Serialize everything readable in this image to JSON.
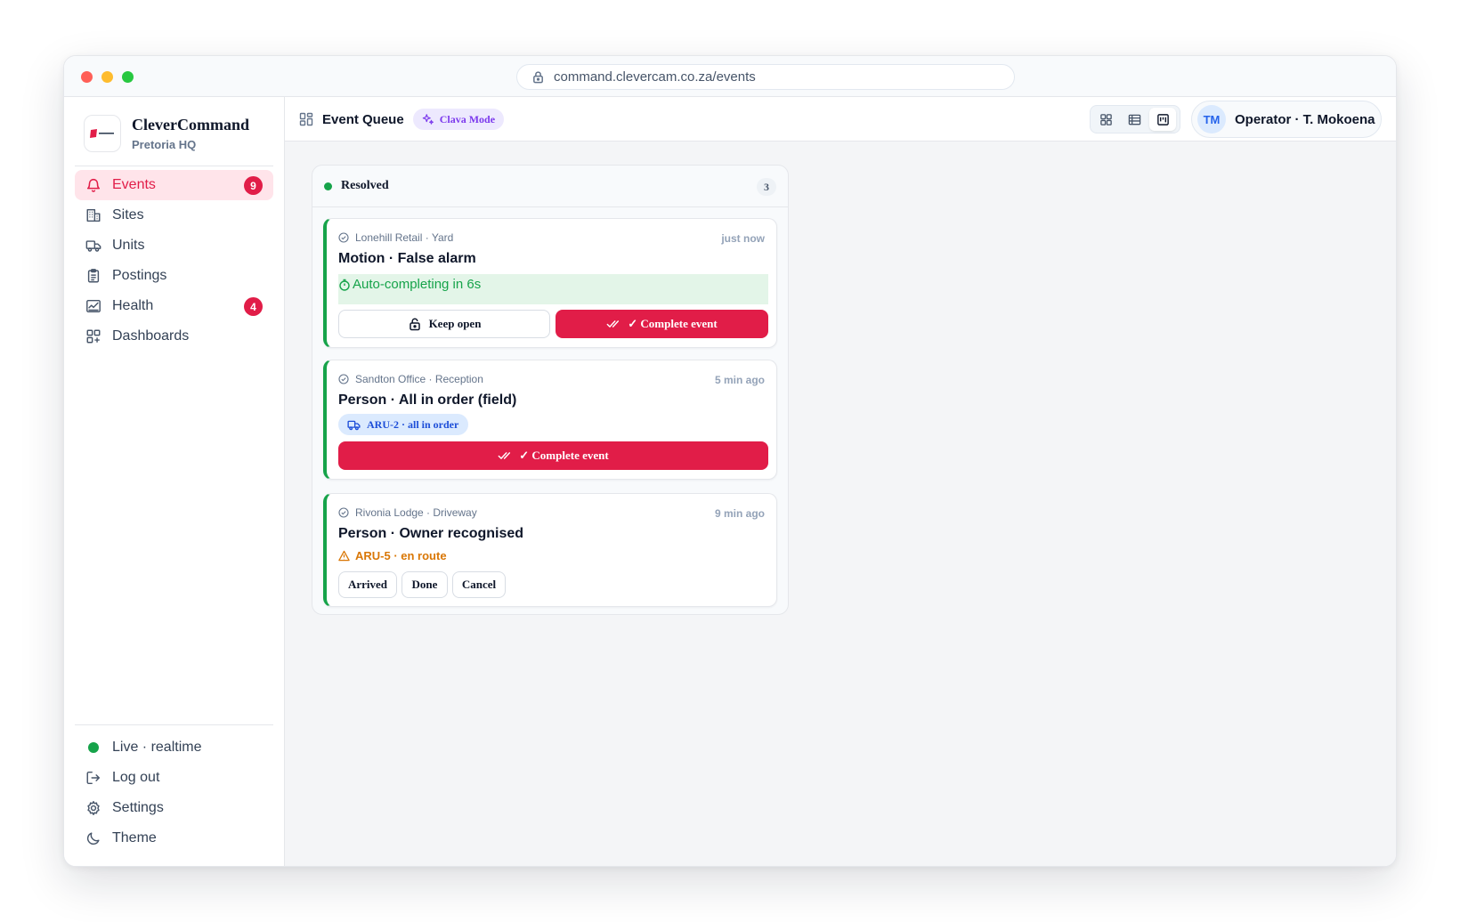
{
  "browser": {
    "url": "command.clevercam.co.za/events"
  },
  "brand": {
    "name": "CleverCommand",
    "subtitle": "Pretoria HQ"
  },
  "sidebar": {
    "items": [
      {
        "label": "Events",
        "badge": "9"
      },
      {
        "label": "Sites"
      },
      {
        "label": "Units"
      },
      {
        "label": "Postings"
      },
      {
        "label": "Health",
        "badge": "4"
      },
      {
        "label": "Dashboards"
      }
    ],
    "bottom": {
      "live": "Live · realtime",
      "logout": "Log out",
      "settings": "Settings",
      "theme": "Theme"
    }
  },
  "topbar": {
    "title": "Event Queue",
    "mode_badge": "Clava Mode",
    "operator_initials": "TM",
    "operator_name": "Operator · T. Mokoena"
  },
  "column": {
    "title": "Resolved",
    "count": "3",
    "status_color": "#16a34a"
  },
  "cards": [
    {
      "site": "Lonehill Retail · Yard",
      "time": "just now",
      "title": "Motion · False alarm",
      "auto": "Auto-completing in 6s",
      "keep_open": "Keep open",
      "complete": "✓ Complete event"
    },
    {
      "site": "Sandton Office · Reception",
      "time": "5 min ago",
      "title": "Person · All in order (field)",
      "unit": "ARU-2 · all in order",
      "complete": "✓ Complete event"
    },
    {
      "site": "Rivonia Lodge · Driveway",
      "time": "9 min ago",
      "title": "Person · Owner recognised",
      "unit_status": "ARU-5 · en route",
      "actions": [
        "Arrived",
        "Done",
        "Cancel"
      ]
    }
  ],
  "colors": {
    "accent": "#e11d48",
    "success": "#16a34a",
    "warning": "#d97706",
    "mode": "#7c3aed"
  }
}
